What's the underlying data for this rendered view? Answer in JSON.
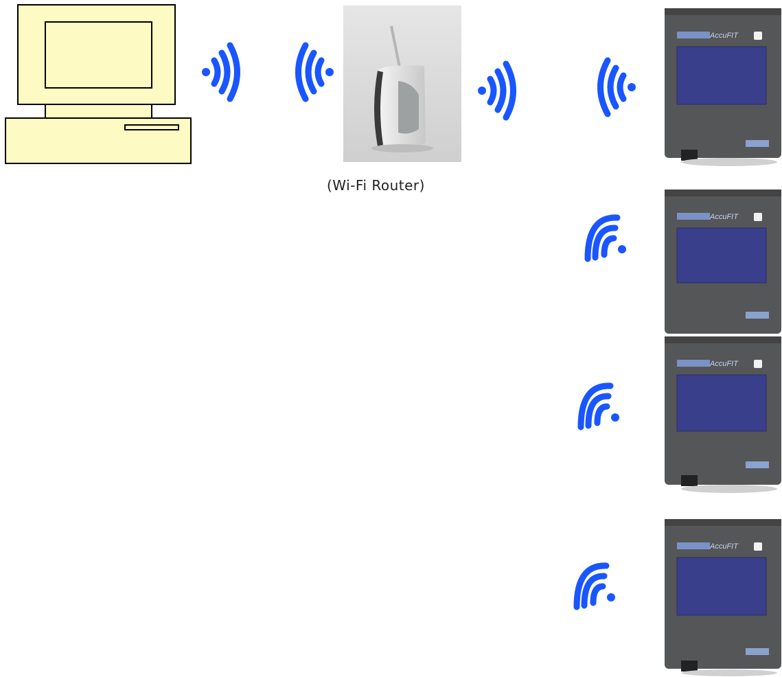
{
  "router_caption": "(Wi-Fi Router)",
  "colors": {
    "signal": "#1a56ff",
    "computer_fill": "#fdfbc3",
    "device_body": "#555657",
    "device_screen": "#3a3f8c"
  },
  "icons": {
    "computer": "desktop-computer-icon",
    "router": "wifi-router-icon",
    "signal": "wireless-signal-icon",
    "device": "wireless-logger-device-icon"
  },
  "devices": [
    {
      "brand": "AccuFIT"
    },
    {
      "brand": "AccuFIT"
    },
    {
      "brand": "AccuFIT"
    },
    {
      "brand": "AccuFIT"
    }
  ]
}
